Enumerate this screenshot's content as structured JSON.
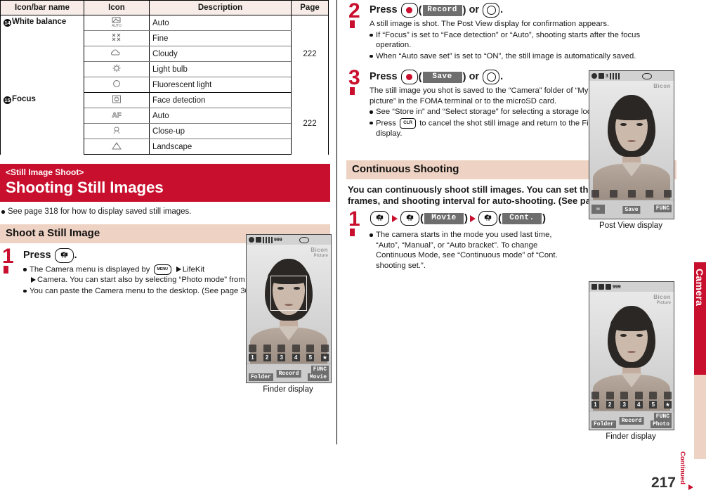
{
  "table": {
    "headers": [
      "Icon/bar name",
      "Icon",
      "Description",
      "Page"
    ],
    "groups": [
      {
        "num": "14",
        "name": "White balance",
        "page": "222",
        "rows": [
          {
            "icon": "auto-white-balance-icon",
            "desc": "Auto"
          },
          {
            "icon": "fine-weather-icon",
            "desc": "Fine"
          },
          {
            "icon": "cloudy-icon",
            "desc": "Cloudy"
          },
          {
            "icon": "light-bulb-icon",
            "desc": "Light bulb"
          },
          {
            "icon": "fluorescent-light-icon",
            "desc": "Fluorescent light"
          }
        ]
      },
      {
        "num": "15",
        "name": "Focus",
        "page": "222",
        "rows": [
          {
            "icon": "face-detection-icon",
            "desc": "Face detection"
          },
          {
            "icon": "auto-focus-icon",
            "desc": "Auto"
          },
          {
            "icon": "close-up-icon",
            "desc": "Close-up"
          },
          {
            "icon": "landscape-icon",
            "desc": "Landscape"
          }
        ]
      }
    ]
  },
  "section": {
    "kicker": "<Still Image Shoot>",
    "title": "Shooting Still Images",
    "note": "See page 318 for how to display saved still images."
  },
  "shoot_still": {
    "heading": "Shoot a Still Image",
    "step1": {
      "number": "1",
      "press_label": "Press",
      "period": ".",
      "key_tv": "TV",
      "bullets": [
        "The Camera menu is displayed by",
        "MENU",
        "LifeKit",
        "Camera. You can start also by selecting “Photo mode” from the Camera menu.",
        "You can paste the Camera menu to the desktop. (See page 30)"
      ]
    },
    "finder_caption": "Finder display"
  },
  "step2": {
    "number": "2",
    "press_label": "Press",
    "softkey": "Record",
    "or_label": "or",
    "period": ".",
    "lead": "A still image is shot. The Post View display for confirmation appears.",
    "bullets": [
      "If “Focus” is set to “Face detection” or “Auto”, shooting starts after the focus operation.",
      "When “Auto save set” is set to “ON”, the still image is automatically saved."
    ]
  },
  "step3": {
    "number": "3",
    "press_label": "Press",
    "softkey": "Save",
    "or_label": "or",
    "period": ".",
    "lead": "The still image you shot is saved to the “Camera” folder of “My picture” in the FOMA terminal or to the microSD card.",
    "bullets": [
      "See “Store in” and “Select storage” for selecting a storage location.",
      "Press",
      "CLR",
      "to cancel the shot still image and return to the Finder display."
    ],
    "post_view_caption": "Post View display"
  },
  "continuous": {
    "heading": "Continuous Shooting",
    "intro": "You can continuously shoot still images. You can set the number of frames, and shooting interval for auto-shooting. (See page 223)",
    "step": {
      "number": "1",
      "key_tv": "TV",
      "softkey_movie": "Movie",
      "softkey_cont": "Cont.",
      "bullet": "The camera starts in the mode you used last time, “Auto”, “Manual”, or “Auto bracket”. To change Continuous Mode, see “Continuous mode” of “Cont. shooting set.”."
    },
    "finder_caption": "Finder display"
  },
  "phone_finder": {
    "brand": "Bicon",
    "brand_sub": "Picture",
    "numbers": [
      "1",
      "2",
      "3",
      "4",
      "5"
    ],
    "softkeys": {
      "top_left": "",
      "bottom_left": "Folder",
      "center": "Record",
      "top_right": "FUNC",
      "bottom_right": "Movie"
    },
    "status_count": "999"
  },
  "phone_postview": {
    "brand": "Bicon",
    "softkeys": {
      "center": "Save",
      "top_right": "FUNC"
    },
    "status_count": "3"
  },
  "phone_cont": {
    "brand": "Bicon",
    "brand_sub": "Picture",
    "numbers": [
      "1",
      "2",
      "3",
      "4",
      "5"
    ],
    "softkeys": {
      "bottom_left": "Folder",
      "center": "Record",
      "top_right": "FUNC",
      "bottom_right": "Photo"
    },
    "status_count": "999"
  },
  "sidebar": {
    "tab_label": "Camera"
  },
  "footer": {
    "page_number": "217",
    "continued": "Continued",
    "arrow": "right-arrow-icon"
  },
  "colors": {
    "accent_red": "#c8102e",
    "header_pink": "#eed2c3",
    "table_header": "#f7ece7"
  }
}
